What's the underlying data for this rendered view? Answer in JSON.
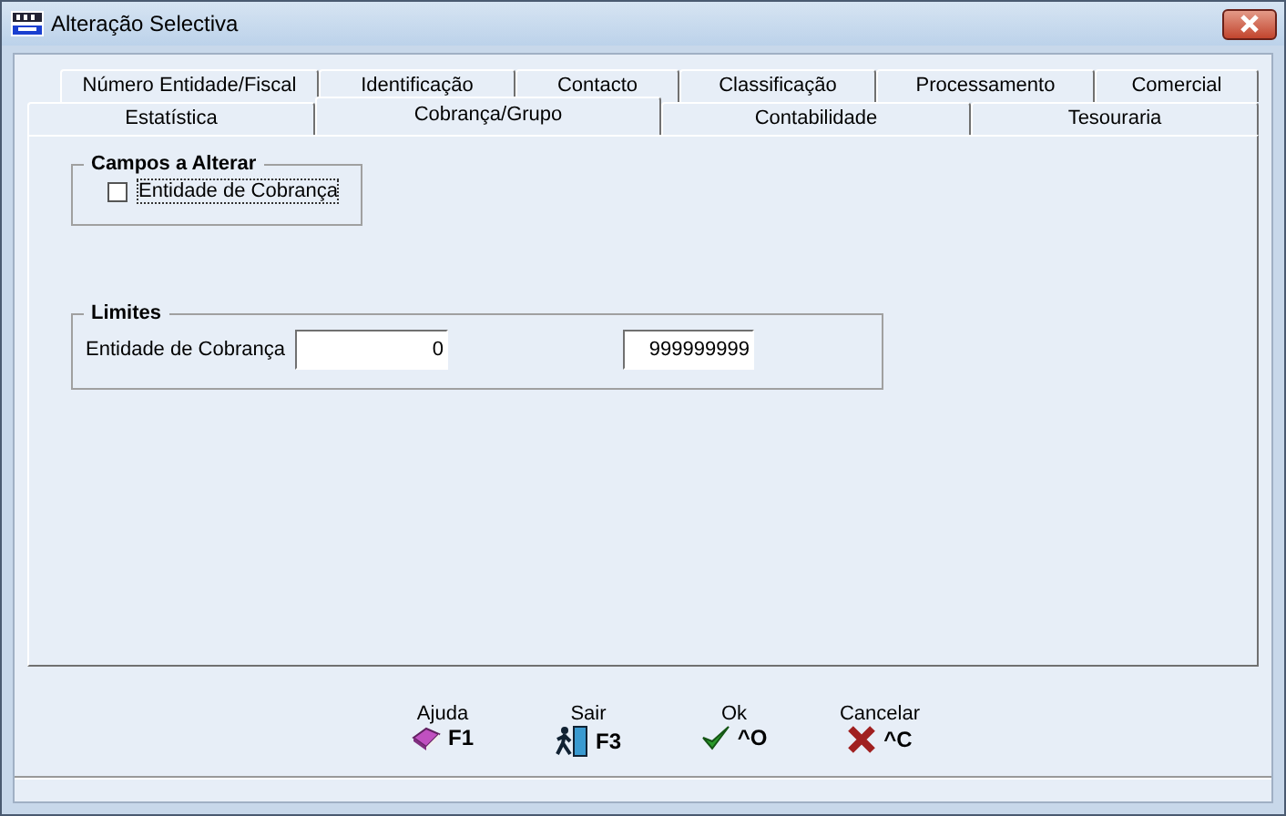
{
  "window": {
    "title": "Alteração Selectiva"
  },
  "tab_rows": [
    [
      {
        "label": "Número Entidade/Fiscal",
        "selected": false
      },
      {
        "label": "Identificação",
        "selected": false
      },
      {
        "label": "Contacto",
        "selected": false
      },
      {
        "label": "Classificação",
        "selected": false
      },
      {
        "label": "Processamento",
        "selected": false
      },
      {
        "label": "Comercial",
        "selected": false
      }
    ],
    [
      {
        "label": "Estatística",
        "selected": false
      },
      {
        "label": "Cobrança/Grupo",
        "selected": true
      },
      {
        "label": "Contabilidade",
        "selected": false
      },
      {
        "label": "Tesouraria",
        "selected": false
      }
    ]
  ],
  "campos_group": {
    "title": "Campos a Alterar",
    "checkbox": {
      "label": "Entidade de Cobrança",
      "checked": false
    }
  },
  "limites_group": {
    "title": "Limites",
    "label": "Entidade de Cobrança",
    "from": "0",
    "to": "999999999"
  },
  "buttons": [
    {
      "kind": "help",
      "label": "Ajuda",
      "shortcut": "F1"
    },
    {
      "kind": "exit",
      "label": "Sair",
      "shortcut": "F3"
    },
    {
      "kind": "ok",
      "label": "Ok",
      "shortcut": "^O"
    },
    {
      "kind": "cancel",
      "label": "Cancelar",
      "shortcut": "^C"
    }
  ]
}
